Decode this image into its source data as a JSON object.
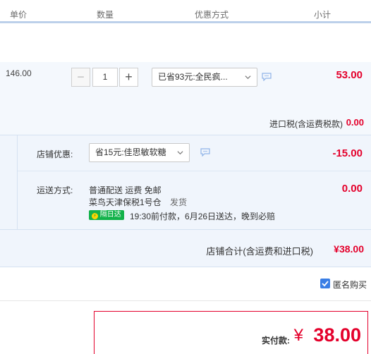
{
  "header": {
    "col_price": "单价",
    "col_qty": "数量",
    "col_promo": "优惠方式",
    "col_subtotal": "小计"
  },
  "item": {
    "unit_price": "146.00",
    "quantity": "1",
    "minus_label": "−",
    "plus_label": "+",
    "promo_select": "已省93元:全民疯...",
    "subtotal": "53.00",
    "tax_label": "进口税(含运费税款)",
    "tax_value": "0.00"
  },
  "shop": {
    "discount_label": "店铺优惠:",
    "discount_select": "省15元:佳思敏软糖",
    "discount_value": "-15.00",
    "shipping_label": "运送方式:",
    "shipping_method": "普通配送 运费 免邮",
    "warehouse": "菜鸟天津保税1号仓",
    "ship_status": "发货",
    "badge": "隔日达",
    "delivery_note": "19:30前付款，6月26日送达，晚到必赔",
    "shipping_value": "0.00",
    "total_label": "店铺合计(含运费和进口税)",
    "total_value": "¥38.00"
  },
  "anonymous": {
    "label": "匿名购买",
    "checked": true
  },
  "payment": {
    "label": "实付款:",
    "currency": "¥",
    "amount": "38.00"
  },
  "colors": {
    "accent_red": "#e4002b",
    "badge_green": "#12b24a",
    "checkbox_blue": "#3a7ee5"
  }
}
